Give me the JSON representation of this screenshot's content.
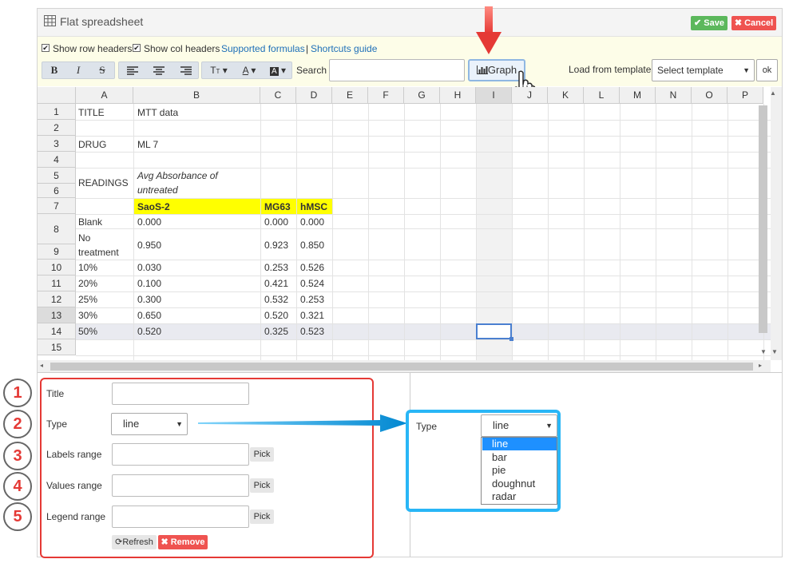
{
  "window": {
    "title": "Flat spreadsheet",
    "save_label": "Save",
    "cancel_label": "Cancel"
  },
  "toolbar": {
    "show_row_headers": "Show row headers",
    "show_col_headers": "Show col headers",
    "supported_formulas": "Supported formulas",
    "separator": "|",
    "shortcuts_guide": "Shortcuts guide",
    "bold": "B",
    "italic": "I",
    "strike": "S",
    "search_label": "Search",
    "search_value": "",
    "graph_label": "Graph",
    "load_template_label": "Load from template",
    "template_select_value": "Select template",
    "ok_label": "ok"
  },
  "grid": {
    "columns": [
      "A",
      "B",
      "C",
      "D",
      "E",
      "F",
      "G",
      "H",
      "I",
      "J",
      "K",
      "L",
      "M",
      "N",
      "O",
      "P"
    ],
    "row_numbers": [
      "1",
      "2",
      "3",
      "4",
      "5",
      "6",
      "7",
      "8",
      "9",
      "10",
      "11",
      "12",
      "13",
      "14",
      "15"
    ],
    "cells": {
      "a1": "TITLE",
      "b1": "MTT data",
      "a3": "DRUG",
      "b3": "ML 7",
      "a5": "READINGS",
      "b5_line1": "Avg Absorbance of",
      "b5_line2": "untreated",
      "b7": "SaoS-2",
      "c7": "MG63",
      "d7": "hMSC",
      "a8": "Blank",
      "b8": "0.000",
      "c8": "0.000",
      "d8": "0.000",
      "a9_line1": "No",
      "a9_line2": "treatment",
      "b9": "0.950",
      "c9": "0.923",
      "d9": "0.850",
      "a10": "10%",
      "b10": "0.030",
      "c10": "0.253",
      "d10": "0.526",
      "a11": "20%",
      "b11": "0.100",
      "c11": "0.421",
      "d11": "0.524",
      "a12": "25%",
      "b12": "0.300",
      "c12": "0.532",
      "d12": "0.253",
      "a13": "30%",
      "b13": "0.650",
      "c13": "0.520",
      "d13": "0.321",
      "a14": "50%",
      "b14": "0.520",
      "c14": "0.325",
      "d14": "0.523"
    }
  },
  "chart_form": {
    "title_label": "Title",
    "title_value": "",
    "type_label": "Type",
    "type_value": "line",
    "labels_range_label": "Labels range",
    "values_range_label": "Values range",
    "legend_range_label": "Legend range",
    "pick_label": "Pick",
    "refresh_label": "Refresh",
    "remove_label": "Remove"
  },
  "callouts": [
    "1",
    "2",
    "3",
    "4",
    "5"
  ],
  "type_dropdown": {
    "label": "Type",
    "selected": "line",
    "options": [
      "line",
      "bar",
      "pie",
      "doughnut",
      "radar"
    ]
  },
  "colors": {
    "save": "#5cb85c",
    "cancel": "#ef5350",
    "highlight_yellow": "#ffff00",
    "annotation_red": "#e53935",
    "annotation_blue": "#29b6f6",
    "link": "#1e6fb8"
  }
}
